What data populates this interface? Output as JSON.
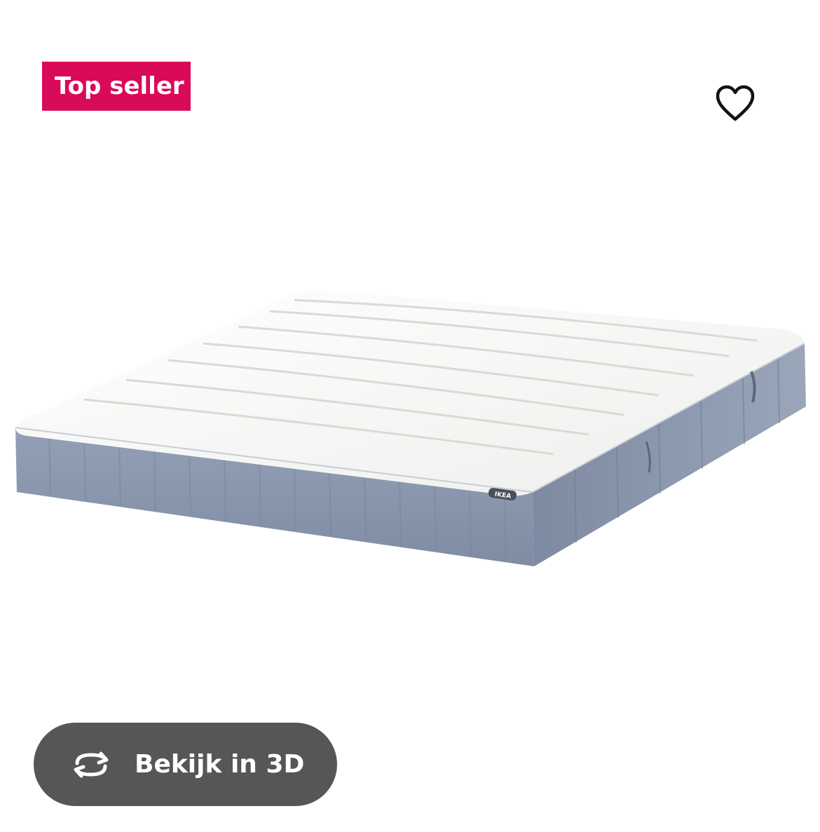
{
  "badge": {
    "label": "Top seller",
    "color": "#d90a59"
  },
  "favorite": {
    "icon": "heart-outline-icon"
  },
  "product": {
    "image_alt": "mattress",
    "brand_tag": "IKEA",
    "colors": {
      "top": "#f6f6f4",
      "side": "#8a97ad"
    }
  },
  "view_3d": {
    "icon": "rotate-3d-icon",
    "label": "Bekijk in 3D",
    "background": "#565656"
  }
}
